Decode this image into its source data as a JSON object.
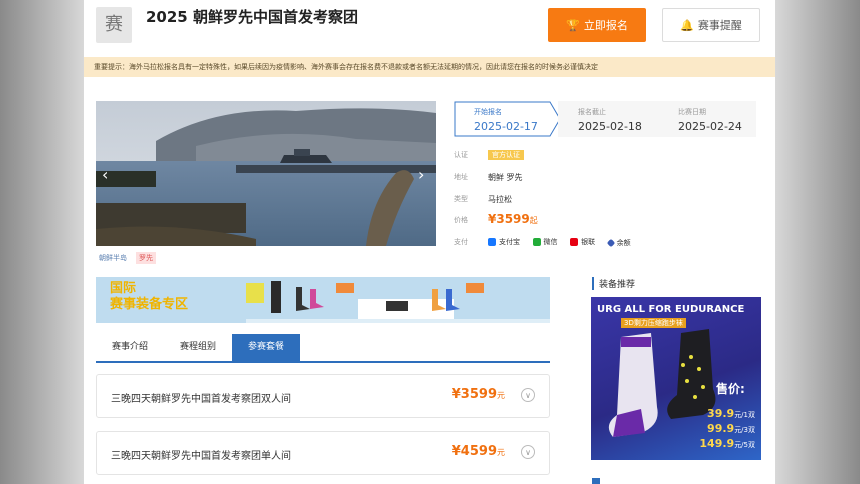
{
  "header": {
    "logo_text": "赛",
    "title": "2025 朝鲜罗先中国首发考察团",
    "register_label": "立即报名",
    "remind_label": "赛事提醒"
  },
  "notice": "重要提示：海外马拉松报名具有一定特殊性，如果后续因为疫情影响、海外赛事会存在报名费不退款或者名额无法延期的情况，因此请您在报名的时候务必谨慎决定",
  "photo": {
    "tags": [
      "朝鲜半岛",
      "罗先"
    ]
  },
  "steps": [
    {
      "label": "开始报名",
      "date": "2025-02-17"
    },
    {
      "label": "报名截止",
      "date": "2025-02-18"
    },
    {
      "label": "比赛日期",
      "date": "2025-02-24"
    }
  ],
  "info": {
    "cert_key": "认证",
    "cert_value": "官方认证",
    "place_key": "地址",
    "place_value": "朝鲜 罗先",
    "type_key": "类型",
    "type_value": "马拉松",
    "price_key": "价格",
    "price_value": "¥3599",
    "price_suffix": "起",
    "pay_key": "支付",
    "pay_methods": [
      {
        "name": "支付宝",
        "color": "#1677ff"
      },
      {
        "name": "微信",
        "color": "#22ac38"
      },
      {
        "name": "银联",
        "color": "#e60012"
      },
      {
        "name": "余额",
        "color": "#3b5bb5"
      }
    ]
  },
  "banner": {
    "line1": "国际",
    "line2": "赛事装备专区"
  },
  "tabs": [
    "赛事介绍",
    "赛程组别",
    "参赛套餐"
  ],
  "active_tab": 2,
  "packages": [
    {
      "name": "三晚四天朝鲜罗先中国首发考察团双人间",
      "price": "¥3599",
      "unit": "元"
    },
    {
      "name": "三晚四天朝鲜罗先中国首发考察团单人间",
      "price": "¥4599",
      "unit": "元"
    }
  ],
  "equip": {
    "title": "装备推荐",
    "ad_head": "URG ALL FOR EUDURANCE",
    "ad_sub": "3D剩力压缩跑步袜",
    "price_label": "售价:",
    "prices": [
      {
        "value": "39.9",
        "unit": "元/1双"
      },
      {
        "value": "99.9",
        "unit": "元/3双"
      },
      {
        "value": "149.9",
        "unit": "元/5双"
      }
    ]
  },
  "colors": {
    "accent": "#f77a12",
    "brand_blue": "#2d6ebc",
    "notice_bg": "#fbe9c8"
  }
}
